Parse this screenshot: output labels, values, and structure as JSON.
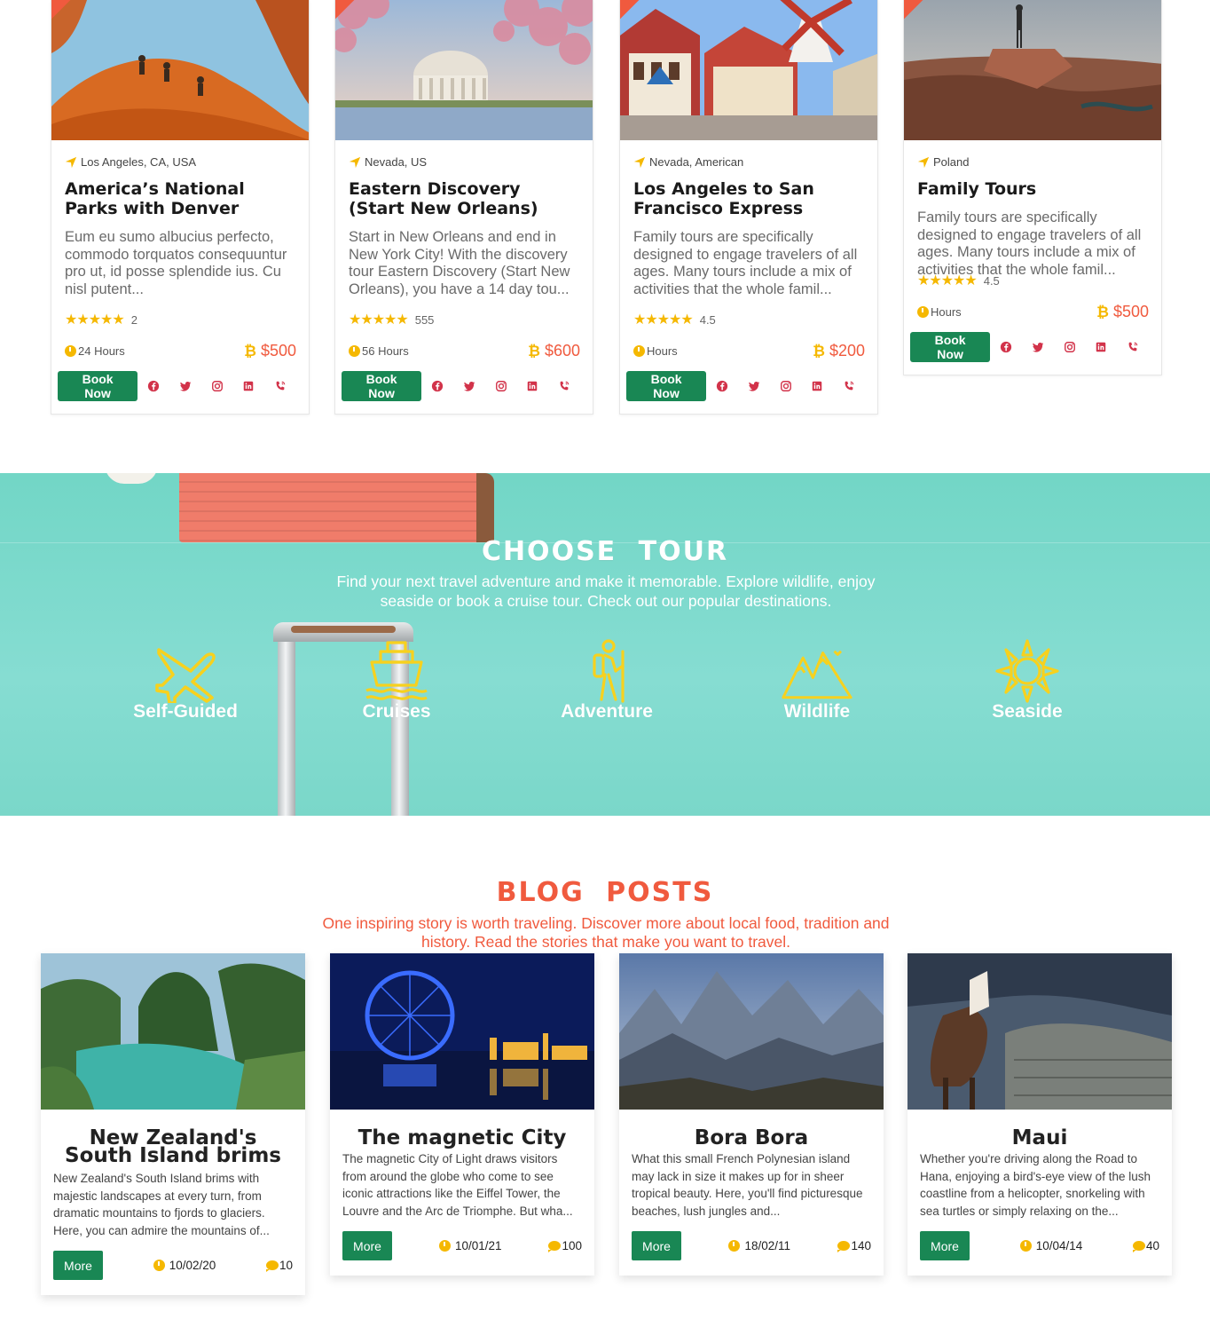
{
  "tours": [
    {
      "location": "Los Angeles, CA, USA",
      "title": "America’s National Parks with Denver",
      "description": "Eum eu sumo albucius perfecto, commodo torquatos consequuntur pro ut, id posse splendide ius. Cu nisl putent...",
      "rating": "2",
      "hours": "24 Hours",
      "price": "$500",
      "book_label": "Book Now"
    },
    {
      "location": "Nevada, US",
      "title": "Eastern Discovery (Start New Orleans)",
      "description": "Start in New Orleans and end in New York City! With the discovery tour Eastern Discovery (Start New Orleans), you have a 14 day tou...",
      "rating": "555",
      "hours": "56 Hours",
      "price": "$600",
      "book_label": "Book Now"
    },
    {
      "location": "Nevada, American",
      "title": "Los Angeles to San Francisco Express",
      "description": "Family tours are specifically designed to engage travelers of all ages. Many tours include a mix of activities that the whole famil...",
      "rating": "4.5",
      "hours": "Hours",
      "price": "$200",
      "book_label": "Book Now"
    },
    {
      "location": "Poland",
      "title": "Family Tours",
      "description": "Family tours are specifically designed to engage travelers of all ages. Many tours include a mix of activities that the whole famil...",
      "rating": "4.5",
      "hours": "Hours",
      "price": "$500",
      "book_label": "Book Now"
    }
  ],
  "social_icons": [
    "facebook-icon",
    "twitter-icon",
    "instagram-icon",
    "linkedin-icon",
    "phone-icon"
  ],
  "choose": {
    "title": "CHOOSE TOUR",
    "subtitle": "Find your next travel adventure and make it memorable. Explore wildlife, enjoy seaside or book a cruise tour. Check out our popular destinations.",
    "categories": [
      {
        "label": "Self-Guided",
        "icon": "airplane-icon"
      },
      {
        "label": "Cruises",
        "icon": "ship-icon"
      },
      {
        "label": "Adventure",
        "icon": "hiker-icon"
      },
      {
        "label": "Wildlife",
        "icon": "mountains-icon"
      },
      {
        "label": "Seaside",
        "icon": "sun-icon"
      }
    ]
  },
  "blog": {
    "title": "BLOG POSTS",
    "subtitle": "One inspiring story is worth traveling. Discover more about local food, tradition and history. Read the stories that make you want to travel.",
    "posts": [
      {
        "title": "New Zealand's South Island brims",
        "text": "New Zealand's South Island brims with majestic landscapes at every turn, from dramatic mountains to fjords to glaciers. Here, you can admire the mountains of...",
        "date": "10/02/20",
        "comments": "10",
        "more_label": "More"
      },
      {
        "title": "The magnetic City",
        "text": "The magnetic City of Light draws visitors from around the globe who come to see iconic attractions like the Eiffel Tower, the Louvre and the Arc de Triomphe. But wha...",
        "date": "10/01/21",
        "comments": "100",
        "more_label": "More"
      },
      {
        "title": "Bora Bora",
        "text": "What this small French Polynesian island may lack in size it makes up for in sheer tropical beauty. Here, you'll find picturesque beaches, lush jungles and...",
        "date": "18/02/11",
        "comments": "140",
        "more_label": "More"
      },
      {
        "title": "Maui",
        "text": "Whether you're driving along the Road to Hana, enjoying a bird's-eye view of the lush coastline from a helicopter, snorkeling with sea turtles or simply relaxing on the...",
        "date": "10/04/14",
        "comments": "40",
        "more_label": "More"
      }
    ]
  },
  "colors": {
    "accent": "#f05a3e",
    "button_green": "#198754",
    "gold": "#f5b800",
    "teal": "#7ad7c9",
    "social_red": "#d2334a"
  }
}
